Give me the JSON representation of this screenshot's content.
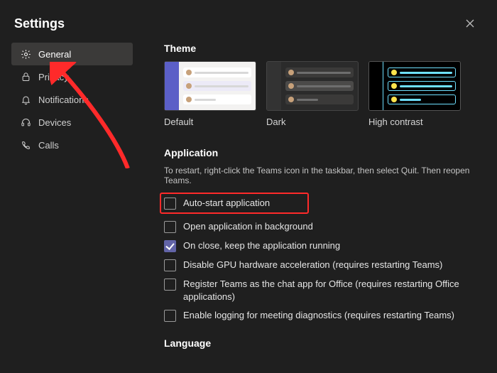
{
  "title": "Settings",
  "sidebar": {
    "items": [
      {
        "label": "General",
        "icon": "gear-icon"
      },
      {
        "label": "Privacy",
        "icon": "lock-icon"
      },
      {
        "label": "Notifications",
        "icon": "bell-icon"
      },
      {
        "label": "Devices",
        "icon": "headset-icon"
      },
      {
        "label": "Calls",
        "icon": "phone-icon"
      }
    ]
  },
  "theme": {
    "heading": "Theme",
    "options": [
      {
        "label": "Default"
      },
      {
        "label": "Dark"
      },
      {
        "label": "High contrast"
      }
    ]
  },
  "application": {
    "heading": "Application",
    "hint": "To restart, right-click the Teams icon in the taskbar, then select Quit. Then reopen Teams.",
    "options": [
      {
        "label": "Auto-start application",
        "checked": false
      },
      {
        "label": "Open application in background",
        "checked": false
      },
      {
        "label": "On close, keep the application running",
        "checked": true
      },
      {
        "label": "Disable GPU hardware acceleration (requires restarting Teams)",
        "checked": false
      },
      {
        "label": "Register Teams as the chat app for Office (requires restarting Office applications)",
        "checked": false
      },
      {
        "label": "Enable logging for meeting diagnostics (requires restarting Teams)",
        "checked": false
      }
    ]
  },
  "language": {
    "heading": "Language"
  },
  "colors": {
    "accent": "#6264a7",
    "highlight": "#ff2a2a"
  }
}
